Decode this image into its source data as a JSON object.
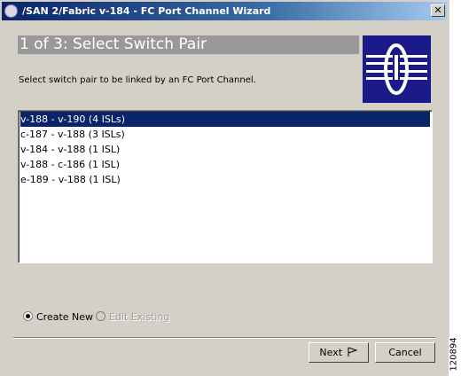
{
  "window": {
    "title": "/SAN 2/Fabric v-184 - FC Port Channel Wizard",
    "close_glyph": "✕"
  },
  "wizard": {
    "step_title": "1 of 3: Select Switch Pair",
    "instruction": "Select switch pair to be linked by an FC Port Channel."
  },
  "switch_pairs": [
    {
      "label": "v-188 - v-190 (4 ISLs)",
      "selected": true
    },
    {
      "label": "c-187 - v-188 (3 ISLs)",
      "selected": false
    },
    {
      "label": "v-184 - v-188 (1 ISL)",
      "selected": false
    },
    {
      "label": "v-188 - c-186 (1 ISL)",
      "selected": false
    },
    {
      "label": "e-189 - v-188 (1 ISL)",
      "selected": false
    }
  ],
  "mode": {
    "create_new_label": "Create New",
    "edit_existing_label": "Edit Existing",
    "selected": "create_new"
  },
  "buttons": {
    "next_label": "Next",
    "cancel_label": "Cancel"
  },
  "figure_code": "120894",
  "colors": {
    "title_bar": "#0a246a",
    "header_bar": "#999999",
    "logo_bg": "#1a1a8a",
    "selection": "#0a246a"
  }
}
